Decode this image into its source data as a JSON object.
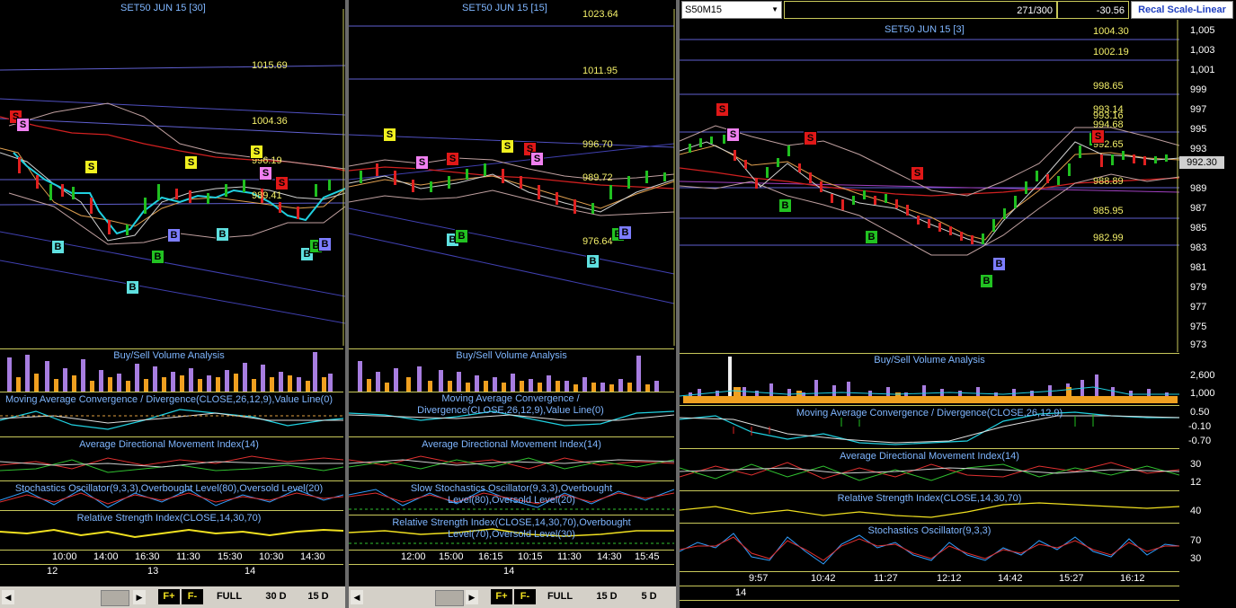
{
  "panel1": {
    "title": "SET50 JUN 15  [30]",
    "levels": [
      "1015.69",
      "1004.36",
      "996.19",
      "989.41"
    ],
    "indicators": {
      "volume": "Buy/Sell Volume Analysis",
      "macd": "Moving Average Convergence / Divergence(CLOSE,26,12,9),Value Line(0)",
      "adx": "Average Directional Movement Index(14)",
      "stoch": "Stochastics Oscillator(9,3,3),Overbought Level(80),Oversold Level(20)",
      "rsi": "Relative Strength Index(CLOSE,14,30,70)"
    },
    "times": [
      "10:00",
      "14:00",
      "16:30",
      "11:30",
      "15:30",
      "10:30",
      "14:30"
    ],
    "days": [
      "12",
      "13",
      "14"
    ],
    "buttons": [
      "F+",
      "F-",
      "FULL",
      "30 D",
      "15 D"
    ]
  },
  "panel2": {
    "title": "SET50 JUN 15  [15]",
    "levels": [
      "1023.64",
      "1011.95",
      "996.70",
      "989.72",
      "976.64"
    ],
    "indicators": {
      "volume": "Buy/Sell Volume Analysis",
      "macd": "Moving Average Convergence / Divergence(CLOSE,26,12,9),Value Line(0)",
      "adx": "Average Directional Movement Index(14)",
      "stoch": "Slow Stochastics Oscillator(9,3,3),Overbought Level(80),Oversold Level(20)",
      "rsi": "Relative Strength Index(CLOSE,14,30,70),Overbought Level(70),Oversold Level(30)"
    },
    "times": [
      "12:00",
      "15:00",
      "16:15",
      "10:15",
      "11:30",
      "14:30",
      "15:45"
    ],
    "days": [
      "14"
    ],
    "buttons": [
      "F+",
      "F-",
      "FULL",
      "15 D",
      "5 D"
    ]
  },
  "panel3": {
    "symbol_select": "S50M15",
    "counter": "271/300",
    "change": "-30.56",
    "recal_button": "Recal Scale-Linear",
    "title": "SET50 JUN 15  [3]",
    "levels": [
      "1004.30",
      "1002.19",
      "998.65",
      "993.14",
      "993.16",
      "994.68",
      "992.65",
      "988.89",
      "985.95",
      "982.99"
    ],
    "current_price": "992.30",
    "yaxis": [
      "1,005",
      "1,003",
      "1,001",
      "999",
      "997",
      "995",
      "993",
      "991",
      "989",
      "987",
      "985",
      "983",
      "981",
      "979",
      "977",
      "975",
      "973"
    ],
    "indicators": {
      "volume": "Buy/Sell Volume Analysis",
      "macd": "Moving Average Convergence / Divergence(CLOSE,26,12,9)",
      "adx": "Average Directional Movement Index(14)",
      "rsi": "Relative Strength Index(CLOSE,14,30,70)",
      "stoch": "Stochastics Oscillator(9,3,3)"
    },
    "vol_axis": [
      "2,600",
      "1,000"
    ],
    "macd_axis": [
      "0.50",
      "-0.10",
      "-0.70"
    ],
    "adx_axis": [
      "30",
      "12"
    ],
    "rsi_axis": [
      "40"
    ],
    "stoch_axis": [
      "70",
      "30"
    ],
    "times": [
      "9:57",
      "10:42",
      "11:27",
      "12:12",
      "14:42",
      "15:27",
      "16:12"
    ],
    "days": [
      "14"
    ]
  },
  "colors": {
    "buy_marker": "#22c222",
    "buy_marker_light": "#5fe0e0",
    "buy_marker_blue": "#7d7dff",
    "sell_marker": "#e01818",
    "sell_marker_yellow": "#f0f020",
    "sell_marker_pink": "#f080f0",
    "level_line": "#c8c85a",
    "title_blue": "#7fb6ff"
  }
}
